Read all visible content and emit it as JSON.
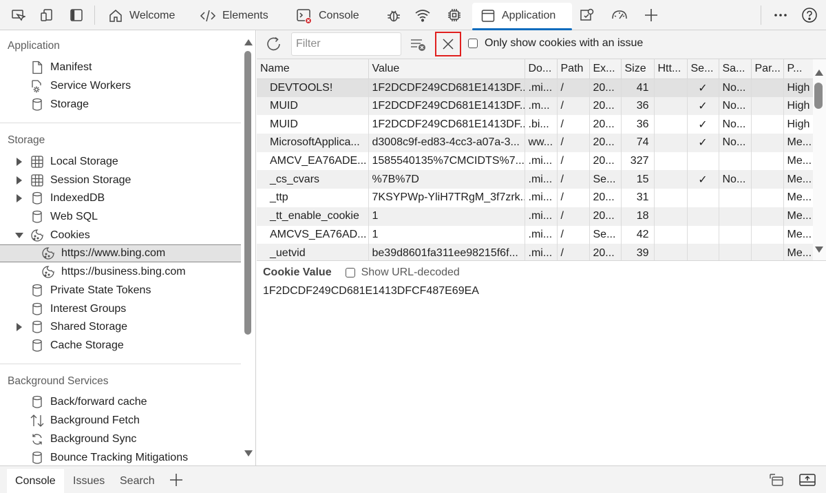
{
  "tabs": [
    {
      "label": "Welcome",
      "icon": "home-icon"
    },
    {
      "label": "Elements",
      "icon": "code-icon"
    },
    {
      "label": "Console",
      "icon": "console-error-icon"
    },
    {
      "label": "Application",
      "icon": "application-icon",
      "active": true
    }
  ],
  "sidebar": {
    "application_heading": "Application",
    "application_items": [
      {
        "label": "Manifest",
        "icon": "document-icon"
      },
      {
        "label": "Service Workers",
        "icon": "gear-icon"
      },
      {
        "label": "Storage",
        "icon": "database-icon"
      }
    ],
    "storage_heading": "Storage",
    "storage_items": [
      {
        "label": "Local Storage",
        "icon": "table-icon"
      },
      {
        "label": "Session Storage",
        "icon": "table-icon"
      },
      {
        "label": "IndexedDB",
        "icon": "database-icon"
      },
      {
        "label": "Web SQL",
        "icon": "database-icon"
      },
      {
        "label": "Cookies",
        "icon": "cookie-icon"
      },
      {
        "label": "https://www.bing.com",
        "icon": "cookie-icon",
        "selected": true
      },
      {
        "label": "https://business.bing.com",
        "icon": "cookie-icon"
      },
      {
        "label": "Private State Tokens",
        "icon": "database-icon"
      },
      {
        "label": "Interest Groups",
        "icon": "database-icon"
      },
      {
        "label": "Shared Storage",
        "icon": "database-icon"
      },
      {
        "label": "Cache Storage",
        "icon": "database-icon"
      }
    ],
    "background_heading": "Background Services",
    "background_items": [
      {
        "label": "Back/forward cache",
        "icon": "database-icon"
      },
      {
        "label": "Background Fetch",
        "icon": "up-down-arrows-icon"
      },
      {
        "label": "Background Sync",
        "icon": "sync-icon"
      },
      {
        "label": "Bounce Tracking Mitigations",
        "icon": "database-icon"
      }
    ]
  },
  "toolbar": {
    "filter_placeholder": "Filter",
    "only_issue_label": "Only show cookies with an issue"
  },
  "cookie_table": {
    "columns": [
      "Name",
      "Value",
      "Do...",
      "Path",
      "Ex...",
      "Size",
      "Htt...",
      "Se...",
      "Sa...",
      "Par...",
      "P..."
    ],
    "rows": [
      [
        "DEVTOOLS!",
        "1F2DCDF249CD681E1413DF...",
        ".mi...",
        "/",
        "20...",
        "41",
        "",
        "✓",
        "No...",
        "",
        "High"
      ],
      [
        "MUID",
        "1F2DCDF249CD681E1413DF...",
        ".m...",
        "/",
        "20...",
        "36",
        "",
        "✓",
        "No...",
        "",
        "High"
      ],
      [
        "MUID",
        "1F2DCDF249CD681E1413DF...",
        ".bi...",
        "/",
        "20...",
        "36",
        "",
        "✓",
        "No...",
        "",
        "High"
      ],
      [
        "MicrosoftApplica...",
        "d3008c9f-ed83-4cc3-a07a-3...",
        "ww...",
        "/",
        "20...",
        "74",
        "",
        "✓",
        "No...",
        "",
        "Me..."
      ],
      [
        "AMCV_EA76ADE...",
        "1585540135%7CMCIDTS%7...",
        ".mi...",
        "/",
        "20...",
        "327",
        "",
        "",
        "",
        "",
        "Me..."
      ],
      [
        "_cs_cvars",
        "%7B%7D",
        ".mi...",
        "/",
        "Se...",
        "15",
        "",
        "✓",
        "No...",
        "",
        "Me..."
      ],
      [
        "_ttp",
        "7KSYPWp-YliH7TRgM_3f7zrk...",
        ".mi...",
        "/",
        "20...",
        "31",
        "",
        "",
        "",
        "",
        "Me..."
      ],
      [
        "_tt_enable_cookie",
        "1",
        ".mi...",
        "/",
        "20...",
        "18",
        "",
        "",
        "",
        "",
        "Me..."
      ],
      [
        "AMCVS_EA76AD...",
        "1",
        ".mi...",
        "/",
        "Se...",
        "42",
        "",
        "",
        "",
        "",
        "Me..."
      ],
      [
        "_uetvid",
        "be39d8601fa311ee98215f6f...",
        ".mi...",
        "/",
        "20...",
        "39",
        "",
        "",
        "",
        "",
        "Me..."
      ]
    ]
  },
  "cookie_value": {
    "title": "Cookie Value",
    "show_decoded_label": "Show URL-decoded",
    "value": "1F2DCDF249CD681E1413DFCF487E69EA"
  },
  "drawer": {
    "tabs": [
      "Console",
      "Issues",
      "Search"
    ]
  },
  "colors": {
    "accent": "#0f6cbd",
    "highlight_border": "#e0201f",
    "error_badge": "#d13438"
  }
}
